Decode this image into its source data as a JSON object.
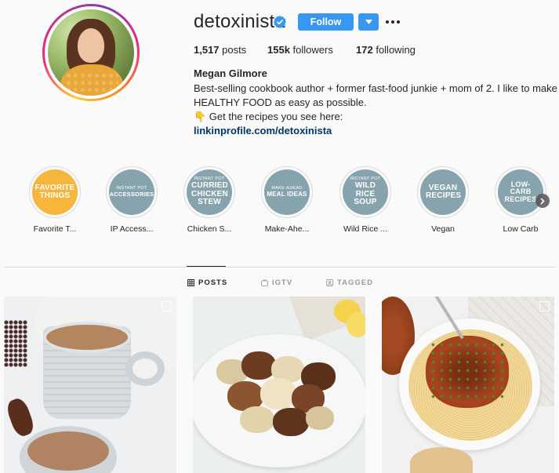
{
  "profile": {
    "username": "detoxinista",
    "verified": true,
    "follow_label": "Follow",
    "dropdown_glyph": "▾",
    "more_glyph": "•••",
    "stats": {
      "posts_count": "1,517",
      "posts_label": "posts",
      "followers_count": "155k",
      "followers_label": "followers",
      "following_count": "172",
      "following_label": "following"
    },
    "full_name": "Megan Gilmore",
    "bio_line1": "Best-selling cookbook author + former fast-food junkie + mom of 2. I like to make",
    "bio_line2": "HEALTHY FOOD as easy as possible.",
    "bio_line3": "👇 Get the recipes you see here:",
    "bio_link": "linkinprofile.com/detoxinista"
  },
  "highlights": [
    {
      "small": "",
      "big": "FAVORITE THINGS",
      "label": "Favorite T...",
      "color": "#f6b63c"
    },
    {
      "small": "INSTANT POT",
      "big": "ACCESSORIES",
      "label": "IP Access...",
      "color": "#87a3ae"
    },
    {
      "small": "INSTANT POT",
      "big": "CURRIED CHICKEN STEW",
      "label": "Chicken S...",
      "color": "#87a3ae"
    },
    {
      "small": "MAKE-AHEAD",
      "big": "MEAL IDEAS",
      "label": "Make-Ahe...",
      "color": "#87a3ae"
    },
    {
      "small": "INSTANT POT",
      "big": "WILD RICE SOUP",
      "label": "Wild Rice ...",
      "color": "#87a3ae"
    },
    {
      "small": "",
      "big": "VEGAN RECIPES",
      "label": "Vegan",
      "color": "#87a3ae"
    },
    {
      "small": "",
      "big": "LOW-CARB RECIPES",
      "label": "Low Carb",
      "color": "#87a3ae"
    }
  ],
  "tabs": {
    "posts": "POSTS",
    "igtv": "IGTV",
    "tagged": "TAGGED",
    "active": "posts"
  },
  "colors": {
    "accent": "#3897f0",
    "link": "#003569",
    "highlight_gray": "#87a3ae",
    "highlight_yellow": "#f6b63c"
  },
  "posts": [
    {
      "subject": "hot cocoa mugs"
    },
    {
      "subject": "roasted cauliflower"
    },
    {
      "subject": "spaghetti with lentil bolognese"
    }
  ]
}
